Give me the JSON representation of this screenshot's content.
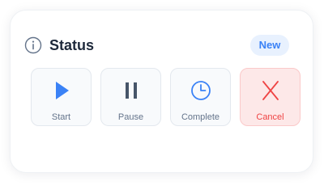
{
  "status_card": {
    "title": "Status",
    "badge": "New",
    "actions": [
      {
        "label": "Start",
        "icon": "play-icon",
        "color": "#3b82f6"
      },
      {
        "label": "Pause",
        "icon": "pause-icon",
        "color": "#475569"
      },
      {
        "label": "Complete",
        "icon": "clock-icon",
        "color": "#3b82f6"
      },
      {
        "label": "Cancel",
        "icon": "close-icon",
        "color": "#ef4444",
        "selected": true
      }
    ]
  },
  "colors": {
    "accent": "#3b82f6",
    "danger": "#ef4444",
    "danger_bg": "#fde8e8",
    "badge_bg": "#e8f1fe",
    "title": "#1e293b",
    "muted": "#64748b"
  }
}
